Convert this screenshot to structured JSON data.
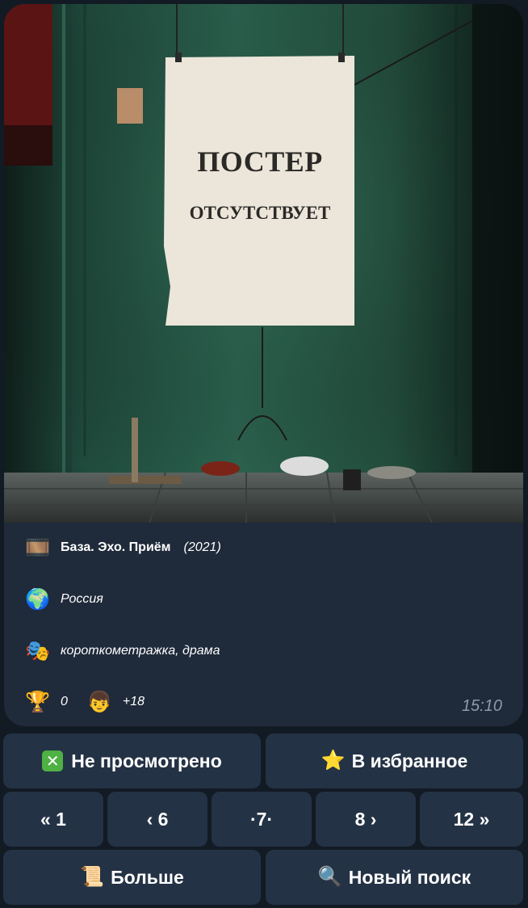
{
  "poster": {
    "heading": "ПОСТЕР",
    "subheading": "ОТСУТСТВУЕТ"
  },
  "movie": {
    "title_icon": "film-frames-icon",
    "title": "База. Эхо. Приём",
    "year": "(2021)",
    "country_icon": "globe-icon",
    "country": "Россия",
    "genres_icon": "theater-masks-icon",
    "genres": "короткометражка, драма",
    "awards_icon": "trophy-icon",
    "awards": "0",
    "age_icon": "child-face-icon",
    "age": "+18",
    "time": "15:10"
  },
  "buttons": {
    "not_watched": "Не просмотрено",
    "favorites": "В избранное",
    "page_first": "« 1",
    "page_prev": "‹ 6",
    "page_current": "·7·",
    "page_next": "8 ›",
    "page_last": "12 »",
    "more": "Больше",
    "new_search": "Новый поиск"
  },
  "colors": {
    "background": "#121a24",
    "bubble": "#1f2a3a",
    "button": "#243245",
    "muted_text": "#8e9bab",
    "check_green": "#4fb044"
  }
}
